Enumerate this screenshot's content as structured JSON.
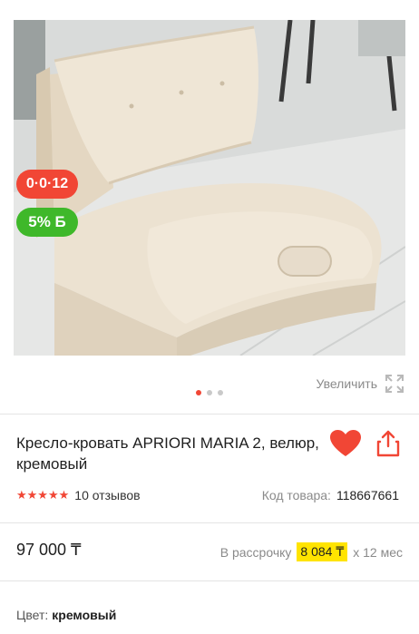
{
  "product": {
    "title": "Кресло-кровать APRIORI MARIA 2, велюр, кремовый",
    "rating_stars": "★★★★★",
    "reviews": "10 отзывов",
    "code_label": "Код товара:",
    "code_value": "118667661",
    "price": "97 000 ₸",
    "installment_label": "В рассрочку",
    "installment_amount": "8 084 ₸",
    "installment_term": "x 12 мес",
    "color_label": "Цвет:",
    "color_value": "кремовый"
  },
  "gallery": {
    "zoom_label": "Увеличить",
    "installment_badge": "0·0·12",
    "bonus_badge": "5% Б",
    "active_slide": 1,
    "slide_count": 3
  },
  "colors": {
    "accent": "#f14635",
    "bonus": "#3fb82a",
    "highlight": "#ffe400"
  }
}
